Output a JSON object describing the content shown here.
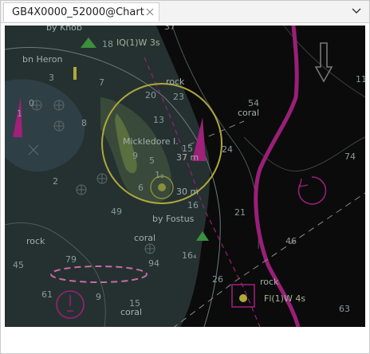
{
  "tab": {
    "title": "GB4X0000_52000@Chart"
  },
  "icons": {
    "close": "close-icon",
    "dropdown": "chevron-down-icon"
  },
  "colors": {
    "deep_water": "#0b0b0b",
    "shoal": "#263333",
    "land": "#3f4a3c",
    "magenta": "#a0207a",
    "circle": "#b8b040"
  },
  "map": {
    "labels": {
      "rock_top": "rock",
      "coral_right": "coral",
      "num_54": "54",
      "mickledore": "Mickledore I.",
      "m37": "37 m",
      "m30": "30 m",
      "by_fostus": "by Fostus",
      "coral_mid": "coral",
      "rock_left": "rock",
      "rock_bottom": "rock",
      "coral_bottom": "coral",
      "fl_light": "Fl(1)W 4s",
      "iq_light": "IQ(1)W 3s",
      "bn_heron": "bn Heron",
      "by_knob": "by Knob"
    },
    "soundings": {
      "s37": "37",
      "s11": "11",
      "s74": "74",
      "s46": "46",
      "s63": "63",
      "s20": "20",
      "s23": "23",
      "s13": "13",
      "s15": "15",
      "s24": "24",
      "s21": "21",
      "s16": "16",
      "s26": "26",
      "s7": "7",
      "s18": "18",
      "s3": "3",
      "s1a": "1",
      "s2a": "2",
      "s49": "49",
      "s45": "45",
      "s61": "61",
      "s9": "9",
      "s79": "79",
      "s94": "94",
      "s164": "16₄",
      "s15b": "15",
      "s6": "6",
      "s5": "5",
      "s12": "1₂",
      "s9b": "9",
      "s8": "8",
      "s0": "0"
    }
  }
}
